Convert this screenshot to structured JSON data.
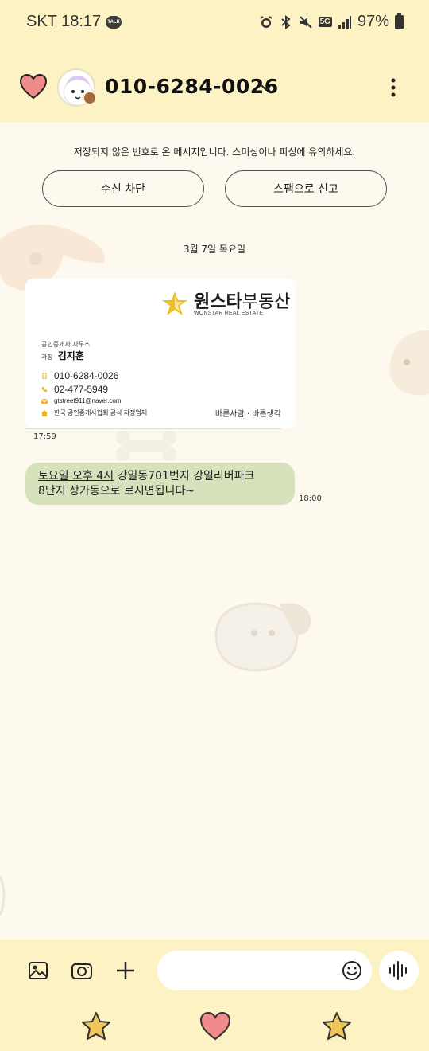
{
  "status_bar": {
    "carrier_time": "SKT 18:17",
    "talk_badge": "TALK",
    "network": "5G",
    "battery": "97%"
  },
  "header": {
    "contact_number": "010-6284-0026",
    "icons": [
      "heart-icon",
      "avatar",
      "chevron-down-icon",
      "more-vert-icon"
    ]
  },
  "warning": {
    "text": "저장되지 않은 번호로 온 메시지입니다. 스미싱이나 피싱에 유의하세요.",
    "block_label": "수신 차단",
    "report_label": "스팸으로 신고"
  },
  "date_divider": "3월 7일 목요일",
  "messages": [
    {
      "type": "business-card",
      "time": "17:59",
      "card": {
        "brand_bold": "원스타",
        "brand_light": "부동산",
        "brand_sub": "WONSTAR REAL ESTATE",
        "org": "공인중개사 사무소",
        "title": "과장",
        "name": "김지훈",
        "phone": "010-6284-0026",
        "tel": "02-477-5949",
        "email": "gtstreet911@naver.com",
        "assoc": "한국 공인중개사협회 공식 지정업체",
        "slogan": "바른사람 · 바른생각"
      }
    },
    {
      "type": "text",
      "time": "18:00",
      "underlined": "토요일 오후 4시",
      "line1_rest": " 강일동701번지 강일리버파크",
      "line2": "8단지 상가동으로 로시면됩니다~"
    }
  ],
  "input": {
    "placeholder": "",
    "icons": [
      "gallery-icon",
      "camera-icon",
      "plus-icon",
      "emoji-icon",
      "voice-icon"
    ]
  },
  "nav_icons": [
    "star-icon",
    "heart-icon",
    "star-icon"
  ],
  "colors": {
    "header_bg": "#fdf2c4",
    "chat_bg": "#fdf9ee",
    "bubble_green": "#d5e2bb",
    "heart_pink": "#f08b8b",
    "star_yellow": "#f0c75a"
  }
}
